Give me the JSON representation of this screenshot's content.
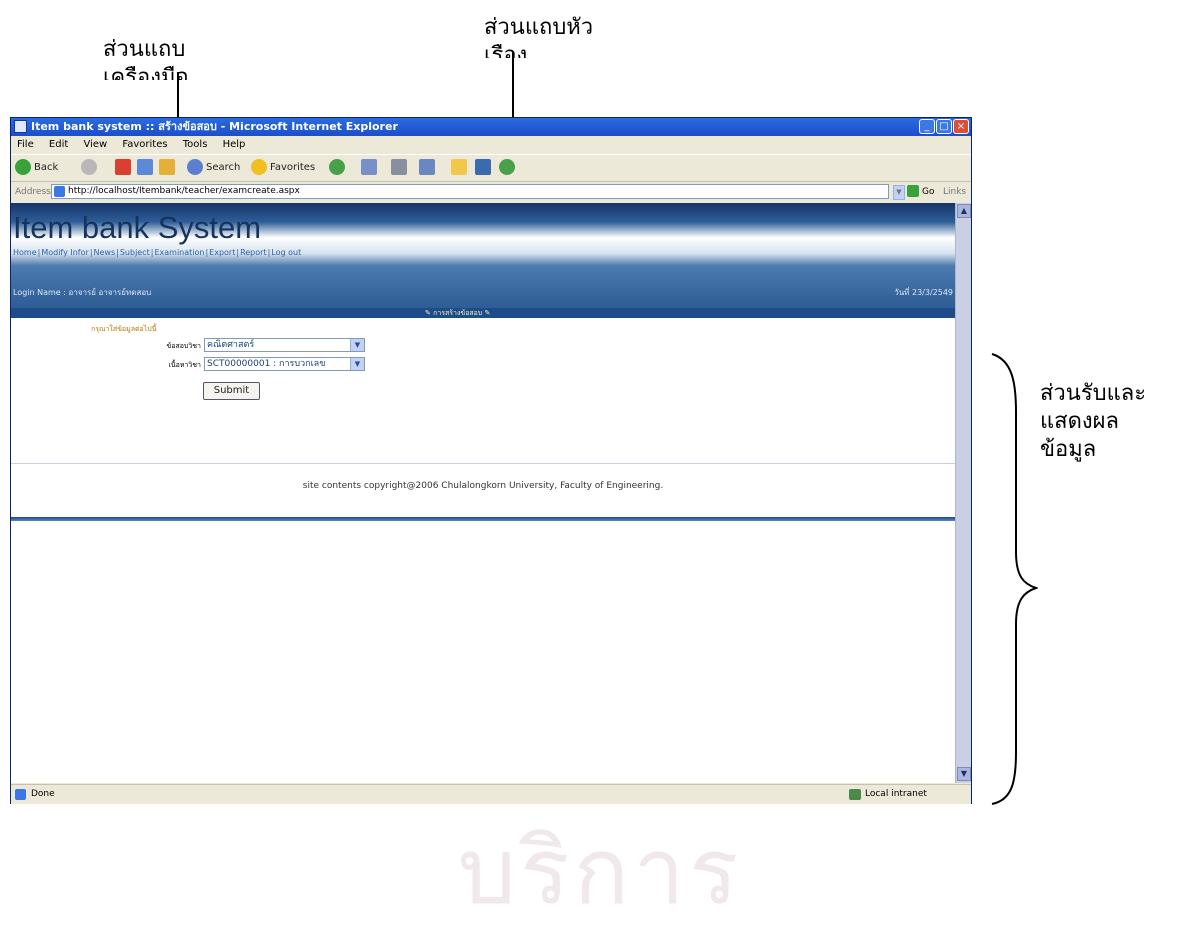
{
  "annotations": {
    "toolbar_label": [
      "ส่วนแถบ",
      "เครื่องมือ"
    ],
    "title_label": [
      "ส่วนแถบหัว",
      "เรื่อง"
    ],
    "data_label": [
      "ส่วนรับและ",
      "แสดงผล",
      "ข้อมูล"
    ]
  },
  "watermark": "สถาบันวิทยบริการ",
  "browser": {
    "title": "Item bank system :: สร้างข้อสอบ - Microsoft Internet Explorer",
    "menu": [
      "File",
      "Edit",
      "View",
      "Favorites",
      "Tools",
      "Help"
    ],
    "toolbar": {
      "back": "Back",
      "search": "Search",
      "favorites": "Favorites"
    },
    "address_label": "Address",
    "url": "http://localhost/Itembank/teacher/examcreate.aspx",
    "go": "Go",
    "links": "Links",
    "status_left": "Done",
    "status_right": "Local intranet"
  },
  "site": {
    "title": "Item bank System",
    "nav": [
      "Home",
      "Modify Infor",
      "News",
      "Subject",
      "Examination",
      "Export",
      "Report",
      "Log out"
    ],
    "login_name": "Login Name : อาจารย์ อาจารย์ทดสอบ",
    "date": "วันที่ 23/3/2549",
    "section_title": "การสร้างข้อสอบ",
    "form": {
      "instruction": "กรุณาใส่ข้อมูลต่อไปนี้",
      "subject_label": "ข้อสอบวิชา",
      "subject_value": "คณิตศาสตร์",
      "content_label": "เนื้อหาวิชา",
      "content_value": "SCT00000001 : การบวกเลข",
      "submit": "Submit"
    },
    "footer": "site contents copyright@2006 Chulalongkorn University, Faculty of Engineering."
  },
  "colors": {
    "header_dark": "#173567",
    "band_blue": "#2e5c94",
    "nav_link": "#2a62a8",
    "instruction": "#b37a00"
  }
}
